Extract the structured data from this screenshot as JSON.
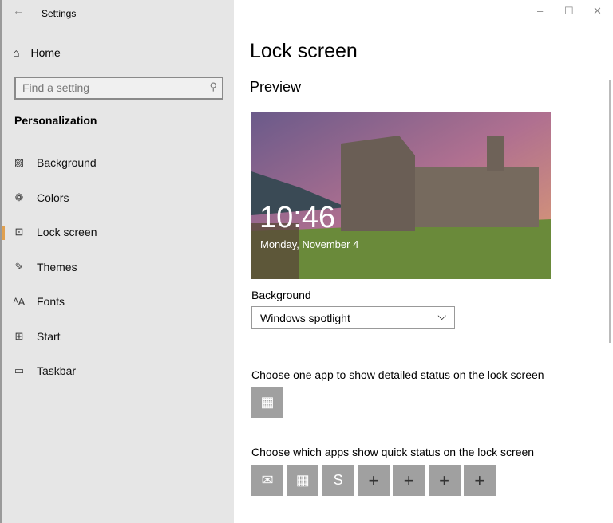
{
  "window": {
    "title": "Settings",
    "minimize": "–",
    "maximize": "☐",
    "close": "✕",
    "back": "←"
  },
  "sidebar": {
    "home": "Home",
    "search_placeholder": "Find a setting",
    "section": "Personalization",
    "items": [
      {
        "label": "Background",
        "icon": "picture-icon",
        "glyph": "▨"
      },
      {
        "label": "Colors",
        "icon": "palette-icon",
        "glyph": "❁"
      },
      {
        "label": "Lock screen",
        "icon": "lock-screen-icon",
        "glyph": "⊡"
      },
      {
        "label": "Themes",
        "icon": "themes-icon",
        "glyph": "✎"
      },
      {
        "label": "Fonts",
        "icon": "fonts-icon",
        "glyph": "ᴬA"
      },
      {
        "label": "Start",
        "icon": "start-icon",
        "glyph": "⊞"
      },
      {
        "label": "Taskbar",
        "icon": "taskbar-icon",
        "glyph": "▭"
      }
    ],
    "selected": "Lock screen",
    "accent": "#e0a050"
  },
  "main": {
    "title": "Lock screen",
    "preview_heading": "Preview",
    "preview_time": "10:46",
    "preview_date": "Monday, November 4",
    "background_label": "Background",
    "background_value": "Windows spotlight",
    "detailed_label": "Choose one app to show detailed status on the lock screen",
    "quick_label": "Choose which apps show quick status on the lock screen",
    "detailed_app": {
      "name": "calendar-icon",
      "glyph": "▦"
    },
    "quick_apps": [
      {
        "name": "mail-icon",
        "glyph": "✉"
      },
      {
        "name": "calendar-icon",
        "glyph": "▦"
      },
      {
        "name": "skype-icon",
        "glyph": "S"
      },
      {
        "name": "add-icon",
        "glyph": "+"
      },
      {
        "name": "add-icon",
        "glyph": "+"
      },
      {
        "name": "add-icon",
        "glyph": "+"
      },
      {
        "name": "add-icon",
        "glyph": "+"
      }
    ]
  }
}
